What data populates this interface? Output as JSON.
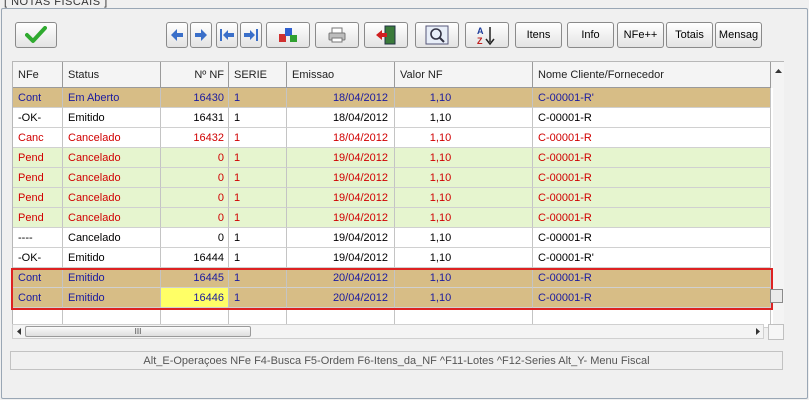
{
  "window": {
    "title": "[ NOTAS FISCAIS ]"
  },
  "toolbar": {
    "buttons": [
      {
        "name": "confirm-button",
        "icon": "checkmark-icon"
      },
      {
        "name": "prev-record-button",
        "icon": "arrow-left-icon"
      },
      {
        "name": "next-record-button",
        "icon": "arrow-right-icon"
      },
      {
        "name": "first-record-button",
        "icon": "arrow-first-icon"
      },
      {
        "name": "last-record-button",
        "icon": "arrow-last-icon"
      },
      {
        "name": "blocks-button",
        "icon": "colored-blocks-icon"
      },
      {
        "name": "print-button",
        "icon": "printer-icon"
      },
      {
        "name": "exit-button",
        "icon": "exit-door-icon"
      },
      {
        "name": "search-button",
        "icon": "magnifier-icon"
      },
      {
        "name": "sort-button",
        "icon": "sort-az-icon"
      }
    ],
    "labels": {
      "itens": "Itens",
      "info": "Info",
      "nfe": "NFe++",
      "totais": "Totais",
      "mensag": "Mensag"
    },
    "sort_glyph": "A Z"
  },
  "grid": {
    "columns": [
      "NFe",
      "Status",
      "Nº NF",
      "SERIE",
      "Emissao",
      "Valor NF",
      "Nome Cliente/Fornecedor"
    ],
    "rows": [
      {
        "nfe": "Cont",
        "status": "Em Aberto",
        "num": "16430",
        "serie": "1",
        "emissao": "18/04/2012",
        "valor": "1,10",
        "nome": "C-00001-R'",
        "style": "gold"
      },
      {
        "nfe": "-OK-",
        "status": "Emitido",
        "num": "16431",
        "serie": "1",
        "emissao": "18/04/2012",
        "valor": "1,10",
        "nome": "C-00001-R",
        "style": "white"
      },
      {
        "nfe": "Canc",
        "status": "Cancelado",
        "num": "16432",
        "serie": "1",
        "emissao": "18/04/2012",
        "valor": "1,10",
        "nome": "C-00001-R",
        "style": "whitered"
      },
      {
        "nfe": "Pend",
        "status": "Cancelado",
        "num": "0",
        "serie": "1",
        "emissao": "19/04/2012",
        "valor": "1,10",
        "nome": "C-00001-R",
        "style": "green"
      },
      {
        "nfe": "Pend",
        "status": "Cancelado",
        "num": "0",
        "serie": "1",
        "emissao": "19/04/2012",
        "valor": "1,10",
        "nome": "C-00001-R",
        "style": "green"
      },
      {
        "nfe": "Pend",
        "status": "Cancelado",
        "num": "0",
        "serie": "1",
        "emissao": "19/04/2012",
        "valor": "1,10",
        "nome": "C-00001-R",
        "style": "green"
      },
      {
        "nfe": "Pend",
        "status": "Cancelado",
        "num": "0",
        "serie": "1",
        "emissao": "19/04/2012",
        "valor": "1,10",
        "nome": "C-00001-R",
        "style": "green"
      },
      {
        "nfe": "----",
        "status": "Cancelado",
        "num": "0",
        "serie": "1",
        "emissao": "19/04/2012",
        "valor": "1,10",
        "nome": "C-00001-R",
        "style": "white"
      },
      {
        "nfe": "-OK-",
        "status": "Emitido",
        "num": "16444",
        "serie": "1",
        "emissao": "19/04/2012",
        "valor": "1,10",
        "nome": "C-00001-R'",
        "style": "white"
      },
      {
        "nfe": "Cont",
        "status": "Emitido",
        "num": "16445",
        "serie": "1",
        "emissao": "20/04/2012",
        "valor": "1,10",
        "nome": "C-00001-R",
        "style": "gold"
      },
      {
        "nfe": "Cont",
        "status": "Emitido",
        "num": "16446",
        "serie": "1",
        "emissao": "20/04/2012",
        "valor": "1,10",
        "nome": "C-00001-R",
        "style": "gold",
        "num_highlight": true
      }
    ]
  },
  "scroll": {
    "thumb_label": "III"
  },
  "status_bar": {
    "text": "Alt_E-Operaçoes NFe   F4-Busca   F5-Ordem  F6-Itens_da_NF   ^F11-Lotes   ^F12-Series   Alt_Y- Menu Fiscal"
  },
  "colors": {
    "gold_row": "#d7bd86",
    "green_row": "#e6f5cf",
    "highlight": "#ffff66",
    "selection_border": "#d22222"
  }
}
